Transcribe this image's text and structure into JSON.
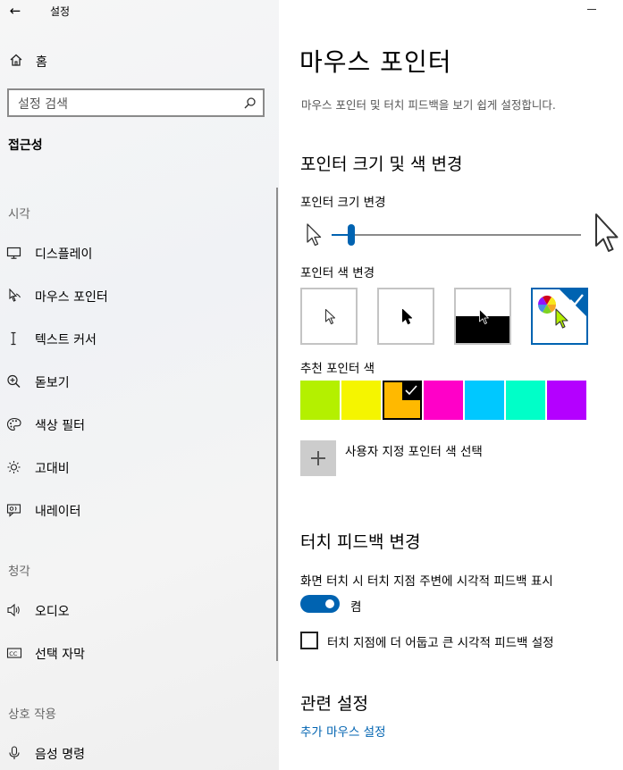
{
  "window": {
    "app_title": "설정",
    "back_glyph": "←"
  },
  "sidebar": {
    "home_label": "홈",
    "search_placeholder": "설정 검색",
    "section_title": "접근성",
    "groups": [
      {
        "title": "시각",
        "items": [
          {
            "label": "디스플레이",
            "icon": "display-icon"
          },
          {
            "label": "마우스 포인터",
            "icon": "mouse-pointer-icon"
          },
          {
            "label": "텍스트 커서",
            "icon": "text-cursor-icon"
          },
          {
            "label": "돋보기",
            "icon": "magnifier-icon"
          },
          {
            "label": "색상 필터",
            "icon": "palette-icon"
          },
          {
            "label": "고대비",
            "icon": "sun-icon"
          },
          {
            "label": "내레이터",
            "icon": "narrator-icon"
          }
        ]
      },
      {
        "title": "청각",
        "items": [
          {
            "label": "오디오",
            "icon": "speaker-icon"
          },
          {
            "label": "선택 자막",
            "icon": "captions-icon"
          }
        ]
      },
      {
        "title": "상호 작용",
        "items": [
          {
            "label": "음성 명령",
            "icon": "microphone-icon"
          }
        ]
      }
    ]
  },
  "main": {
    "title": "마우스 포인터",
    "description": "마우스 포인터 및 터치 피드백을 보기 쉽게 설정합니다.",
    "pointer_section": {
      "heading": "포인터 크기 및 색 변경",
      "size_label": "포인터 크기 변경",
      "size_value": 0.08,
      "color_label": "포인터 색 변경",
      "color_options": [
        "white",
        "black",
        "inverted",
        "custom"
      ],
      "selected_color_option": "custom",
      "suggested_label": "추천 포인터 색",
      "suggested_colors": [
        "#b4f000",
        "#f5f500",
        "#ffb900",
        "#ff00c8",
        "#00c8ff",
        "#00ffc8",
        "#b400ff"
      ],
      "selected_suggested_index": 2,
      "custom_color_label": "사용자 지정 포인터 색 선택"
    },
    "touch_section": {
      "heading": "터치 피드백 변경",
      "toggle_label": "화면 터치 시 터치 지점 주변에 시각적 피드백 표시",
      "toggle_state": "켬",
      "checkbox_label": "터치 지점에 더 어둡고 큰 시각적 피드백 설정",
      "checkbox_checked": false
    },
    "related_section": {
      "heading": "관련 설정",
      "link_label": "추가 마우스 설정"
    }
  },
  "colors": {
    "accent": "#0063b1",
    "chosen_pointer": "#b4f000"
  }
}
